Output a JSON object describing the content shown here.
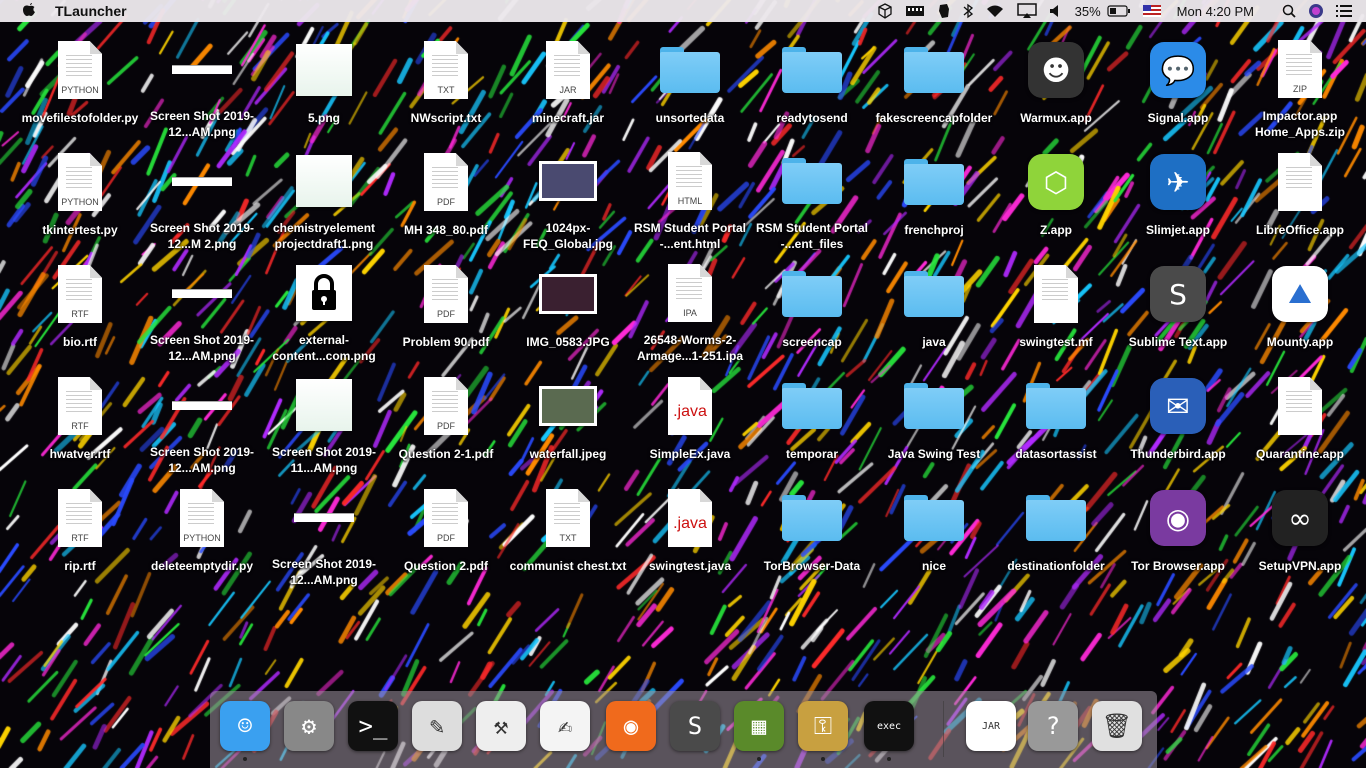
{
  "menubar": {
    "apple_icon": "apple-icon",
    "app_name": "TLauncher",
    "battery_percent": "35%",
    "clock": "Mon 4:20 PM",
    "status_icons": [
      "virtualbox-icon",
      "ram-icon",
      "evernote-icon",
      "bluetooth-icon",
      "wifi-icon",
      "airplay-icon",
      "volume-icon",
      "battery-icon",
      "flag-input-icon",
      "spotlight-icon",
      "siri-icon",
      "notification-center-icon"
    ]
  },
  "desktop": {
    "columns": [
      [
        {
          "label": "movefilestofolder.py",
          "type": "doc",
          "ext": "PYTHON"
        },
        {
          "label": "tkintertest.py",
          "type": "doc",
          "ext": "PYTHON"
        },
        {
          "label": "bio.rtf",
          "type": "doc",
          "ext": "RTF"
        },
        {
          "label": "hwatver.rtf",
          "type": "doc",
          "ext": "RTF"
        },
        {
          "label": "rip.rtf",
          "type": "doc",
          "ext": "RTF"
        }
      ],
      [
        {
          "label": "Screen Shot 2019-12...AM.png",
          "type": "shot"
        },
        {
          "label": "Screen Shot 2019-12...M 2.png",
          "type": "shot"
        },
        {
          "label": "Screen Shot 2019-12...AM.png",
          "type": "shot"
        },
        {
          "label": "Screen Shot 2019-12...AM.png",
          "type": "shot"
        },
        {
          "label": "deleteemptydir.py",
          "type": "doc",
          "ext": "PYTHON"
        }
      ],
      [
        {
          "label": "5.png",
          "type": "thumb"
        },
        {
          "label": "chemistryelement projectdraft1.png",
          "type": "thumb"
        },
        {
          "label": "external-content...com.png",
          "type": "lock"
        },
        {
          "label": "Screen Shot 2019-11...AM.png",
          "type": "thumb"
        },
        {
          "label": "Screen Shot 2019-12...AM.png",
          "type": "shot"
        }
      ],
      [
        {
          "label": "NWscript.txt",
          "type": "doc",
          "ext": "TXT"
        },
        {
          "label": "MH 348_80.pdf",
          "type": "doc",
          "ext": "PDF"
        },
        {
          "label": "Problem 90.pdf",
          "type": "doc",
          "ext": "PDF"
        },
        {
          "label": "Question 2-1.pdf",
          "type": "doc",
          "ext": "PDF"
        },
        {
          "label": "Question 2.pdf",
          "type": "doc",
          "ext": "PDF"
        }
      ],
      [
        {
          "label": "minecraft.jar",
          "type": "doc",
          "ext": "JAR"
        },
        {
          "label": "1024px-FEQ_Global.jpg",
          "type": "photo",
          "color": "#4a4a70"
        },
        {
          "label": "IMG_0583.JPG",
          "type": "photo",
          "color": "#3a2030"
        },
        {
          "label": "waterfall.jpeg",
          "type": "photo",
          "color": "#5a6a50"
        },
        {
          "label": "communist chest.txt",
          "type": "doc",
          "ext": "TXT"
        }
      ],
      [
        {
          "label": "unsortedata",
          "type": "folder"
        },
        {
          "label": "RSM Student Portal -...ent.html",
          "type": "doc",
          "ext": "HTML"
        },
        {
          "label": "26548-Worms-2-Armage...1-251.ipa",
          "type": "doc",
          "ext": "IPA"
        },
        {
          "label": "SimpleEx.java",
          "type": "java"
        },
        {
          "label": "swingtest.java",
          "type": "java"
        }
      ],
      [
        {
          "label": "readytosend",
          "type": "folder"
        },
        {
          "label": "RSM Student Portal -...ent_files",
          "type": "folder"
        },
        {
          "label": "screencap",
          "type": "folder"
        },
        {
          "label": "temporar",
          "type": "folder"
        },
        {
          "label": "TorBrowser-Data",
          "type": "folder"
        }
      ],
      [
        {
          "label": "fakescreencapfolder",
          "type": "folder"
        },
        {
          "label": "frenchproj",
          "type": "folder"
        },
        {
          "label": "java",
          "type": "folder"
        },
        {
          "label": "Java Swing Test",
          "type": "folder"
        },
        {
          "label": "nice",
          "type": "folder"
        }
      ],
      [
        {
          "label": "Warmux.app",
          "type": "app",
          "color": "#333333",
          "glyph": "☻"
        },
        {
          "label": "Z.app",
          "type": "app",
          "color": "#8fd43a",
          "glyph": "⬡"
        },
        {
          "label": "swingtest.mf",
          "type": "doc",
          "ext": ""
        },
        {
          "label": "datasortassist",
          "type": "folder"
        },
        {
          "label": "destinationfolder",
          "type": "folder"
        }
      ],
      [
        {
          "label": "Signal.app",
          "type": "app",
          "color": "#2b8be8",
          "glyph": "💬"
        },
        {
          "label": "Slimjet.app",
          "type": "app",
          "color": "#1e6fc4",
          "glyph": "✈"
        },
        {
          "label": "Sublime Text.app",
          "type": "app",
          "color": "#4a4a4a",
          "glyph": "S"
        },
        {
          "label": "Thunderbird.app",
          "type": "app",
          "color": "#2a5fb8",
          "glyph": "✉"
        },
        {
          "label": "Tor Browser.app",
          "type": "app",
          "color": "#7a3aa0",
          "glyph": "◉"
        }
      ],
      [
        {
          "label": "Impactor.app Home_Apps.zip",
          "type": "doc",
          "ext": "ZIP"
        },
        {
          "label": "LibreOffice.app",
          "type": "doc",
          "ext": ""
        },
        {
          "label": "Mounty.app",
          "type": "app",
          "color": "#ffffff",
          "glyph": "⛰"
        },
        {
          "label": "Quarantine.app",
          "type": "doc",
          "ext": ""
        },
        {
          "label": "SetupVPN.app",
          "type": "app",
          "color": "#222222",
          "glyph": "∞"
        }
      ]
    ]
  },
  "dock": {
    "items": [
      {
        "name": "finder-icon",
        "color": "#3aa0f0",
        "glyph": "☺",
        "running": true
      },
      {
        "name": "system-preferences-icon",
        "color": "#888888",
        "glyph": "⚙",
        "running": false
      },
      {
        "name": "terminal-icon",
        "color": "#111111",
        "glyph": ">_",
        "running": false
      },
      {
        "name": "script-editor-icon",
        "color": "#dddddd",
        "glyph": "✎",
        "running": false
      },
      {
        "name": "xcode-instruments-icon",
        "color": "#eeeeee",
        "glyph": "⚒",
        "running": false
      },
      {
        "name": "textedit-icon",
        "color": "#f4f4f4",
        "glyph": "✍",
        "running": false
      },
      {
        "name": "firefox-icon",
        "color": "#f06a1c",
        "glyph": "◉",
        "running": false
      },
      {
        "name": "sublime-text-icon",
        "color": "#4a4a4a",
        "glyph": "S",
        "running": false
      },
      {
        "name": "minecraft-icon",
        "color": "#5a8a2a",
        "glyph": "▦",
        "running": true
      },
      {
        "name": "keychain-access-icon",
        "color": "#c8a040",
        "glyph": "⚿",
        "running": true
      },
      {
        "name": "exec-terminal-icon",
        "color": "#111111",
        "glyph": "exec",
        "running": true
      },
      {
        "name": "jar-file-icon",
        "color": "#ffffff",
        "glyph": "JAR",
        "running": false
      },
      {
        "name": "unknown-app-icon",
        "color": "#999999",
        "glyph": "?",
        "running": false
      },
      {
        "name": "trash-icon",
        "color": "#e0e0e0",
        "glyph": "🗑",
        "running": false
      }
    ]
  }
}
